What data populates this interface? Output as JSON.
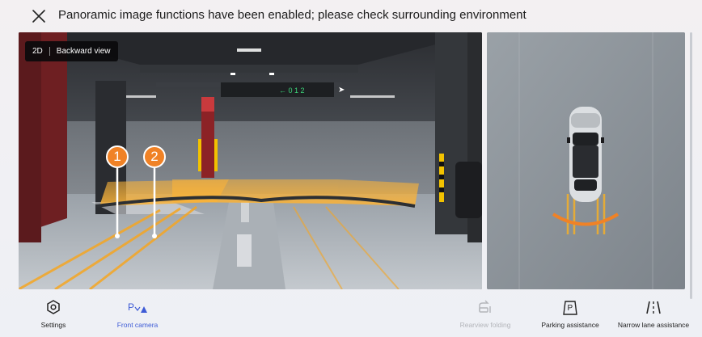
{
  "banner": {
    "message": "Panoramic image functions have been enabled; please check surrounding environment",
    "close_icon": "close-icon"
  },
  "camera": {
    "mode": "2D",
    "view": "Backward view",
    "markers": [
      "1",
      "2"
    ],
    "overlay_color": "#f5a623"
  },
  "toolbar": {
    "settings": {
      "label": "Settings",
      "icon": "settings-icon"
    },
    "front_camera": {
      "label": "Front camera",
      "icon": "front-camera-icon",
      "active": true
    },
    "rearview_folding": {
      "label": "Rearview folding",
      "icon": "rearview-folding-icon",
      "disabled": true
    },
    "parking_assistance": {
      "label": "Parking assistance",
      "icon": "parking-assistance-icon"
    },
    "narrow_lane": {
      "label": "Narrow lane assistance",
      "icon": "narrow-lane-icon"
    }
  },
  "colors": {
    "accent": "#3d5bd6",
    "guide": "#f5a623",
    "marker": "#f08226"
  }
}
